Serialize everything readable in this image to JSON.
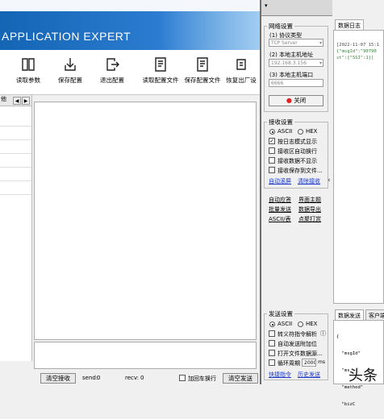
{
  "app": {
    "title_banner": "APPLICATION EXPERT"
  },
  "toolbar": {
    "buttons": [
      {
        "label": "读取参数",
        "icon": "book-icon"
      },
      {
        "label": "保存配置",
        "icon": "save-icon"
      },
      {
        "label": "退出配置",
        "icon": "exit-icon"
      },
      {
        "label": "读取配置文件",
        "icon": "file-icon"
      },
      {
        "label": "保存配置文件",
        "icon": "file-save-icon"
      },
      {
        "label": "恢复出厂设",
        "icon": "restore-icon"
      }
    ]
  },
  "left_panel": {
    "tab_label": "他"
  },
  "status": {
    "clear_recv": "清空接收",
    "send_label": "send:",
    "send_value": "0",
    "recv_label": "recv:",
    "recv_value": "0",
    "add_newline": "加回车换行",
    "clear_send": "清空发送"
  },
  "side": {
    "network": {
      "legend": "网络设置",
      "protocol_label": "(1) 协议类型",
      "protocol_value": "TCP Server",
      "host_label": "(2) 本地主机地址",
      "host_value": "192.168.3.156",
      "port_label": "(3) 本地主机端口",
      "port_value": "6666",
      "close_button": "关闭"
    },
    "recv": {
      "legend": "接收设置",
      "ascii": "ASCII",
      "hex": "HEX",
      "opt1": "按日志模式显示",
      "opt2": "接收区自动换行",
      "opt3": "接收数据不显示",
      "opt4": "接收保存到文件...",
      "link_autoscroll": "自动滚屏",
      "link_clear": "清除接收"
    },
    "mid_links": {
      "auto_answer": "自动应答",
      "theme": "界面主题",
      "batch_send": "批量发送",
      "export": "数据导出",
      "ascii_table": "ASCII/表",
      "click_stop": "点聚打赏"
    },
    "send": {
      "legend": "发送设置",
      "ascii": "ASCII",
      "hex": "HEX",
      "opt1": "转义符指令解析",
      "opt2": "自动发送附加位",
      "opt3": "打开文件数据源...",
      "opt4": "循环周期",
      "period_value": "2000",
      "period_unit": "ms",
      "link_shortcut": "快捷指令",
      "link_history": "历史发送"
    }
  },
  "right": {
    "tab_log": "数据日志",
    "log_lines": [
      "[2022-11-07 15:1",
      "{\"msgId\":\"90790",
      "st\":{\"SSI\":1}]"
    ],
    "tab_data": "数据发送",
    "tab_client": "客户端",
    "data_lines": [
      "{",
      "  \"msgId\"",
      "  \"ms",
      "  \"method\"",
      "  \"bizC"
    ],
    "watermark": "头条"
  }
}
